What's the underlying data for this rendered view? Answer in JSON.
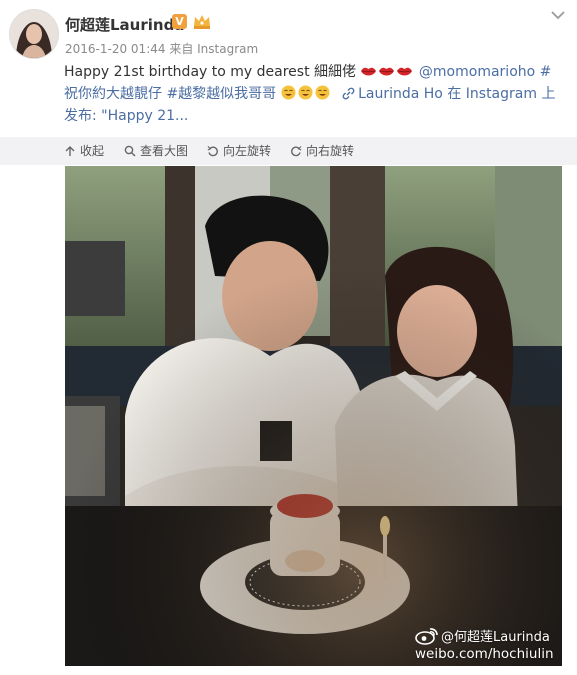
{
  "post": {
    "author": "何超莲Laurinda",
    "verified_badge": "V",
    "timestamp": "2016-1-20 01:44",
    "source": "来自 Instagram",
    "text_main": "Happy 21st birthday to my dearest 細細佬",
    "mention": "@momomarioho",
    "hashtag1": "#祝你約大越靚仔",
    "hashtag2": "#越黎越似我哥哥",
    "link_text": "Laurinda Ho 在 Instagram 上发布: \"Happy 21..."
  },
  "toolbar": {
    "collapse": "收起",
    "view_large": "查看大图",
    "rotate_left": "向左旋转",
    "rotate_right": "向右旋转"
  },
  "watermark": {
    "handle": "@何超莲Laurinda",
    "url": "weibo.com/hochiulin"
  },
  "colors": {
    "link": "#4b6ea3",
    "toolbar_bg": "#f2f2f5",
    "verified": "#f0a03c"
  }
}
